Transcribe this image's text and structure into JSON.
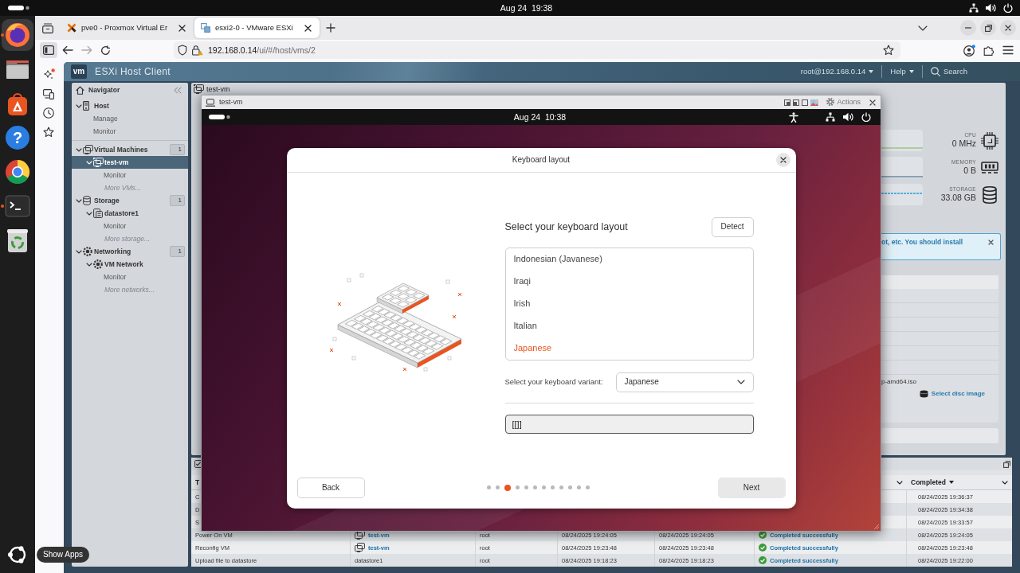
{
  "desktop": {
    "clock": "Aug 24  19:38"
  },
  "dock": {
    "items": [
      {
        "kind": "browser",
        "running": true,
        "focused": true
      },
      {
        "kind": "files",
        "running": false,
        "focused": false
      },
      {
        "kind": "app_center",
        "running": false,
        "focused": false
      },
      {
        "kind": "help",
        "glyph": "?",
        "running": false,
        "focused": false
      },
      {
        "kind": "chromium",
        "running": false,
        "focused": false
      },
      {
        "kind": "terminal",
        "running": true,
        "focused": false
      },
      {
        "kind": "trash",
        "running": false,
        "focused": false
      }
    ],
    "show_apps": {
      "tooltip": "Show Apps"
    }
  },
  "browser": {
    "tabs": [
      {
        "kind": "x_logo",
        "title": "pve0 - Proxmox Virtual Er",
        "selected": false
      },
      {
        "kind": "squares_logo",
        "title": "esxi2-0 - VMware ESXi",
        "selected": true
      }
    ],
    "url": {
      "host": "192.168.0.14",
      "path": "/ui/#/host/vms/2"
    }
  },
  "esxi": {
    "logo": "vm",
    "title": "ESXi Host Client",
    "user_menu": "root@192.168.0.14",
    "help_menu": "Help",
    "search": "Search",
    "navigator": {
      "title": "Navigator",
      "tree": [
        {
          "label": "Host",
          "kind": "host",
          "expanded": true,
          "selected": false,
          "children": [
            {
              "label": "Manage",
              "kind": "page",
              "selected": false
            },
            {
              "label": "Monitor",
              "kind": "page",
              "selected": false
            }
          ]
        },
        {
          "label": "Virtual Machines",
          "kind": "vms",
          "count": "1",
          "expanded": true,
          "selected": false,
          "children": [
            {
              "label": "test-vm",
              "kind": "vm",
              "running": true,
              "expanded": true,
              "selected": true,
              "children": [
                {
                  "label": "Monitor",
                  "kind": "page",
                  "selected": false
                }
              ]
            },
            {
              "label": "More VMs...",
              "kind": "more",
              "selected": false
            }
          ]
        },
        {
          "label": "Storage",
          "kind": "storage",
          "count": "1",
          "expanded": true,
          "selected": false,
          "children": [
            {
              "label": "datastore1",
              "kind": "datastore",
              "expanded": true,
              "selected": false,
              "children": [
                {
                  "label": "Monitor",
                  "kind": "page",
                  "selected": false
                }
              ]
            },
            {
              "label": "More storage...",
              "kind": "more",
              "selected": false
            }
          ]
        },
        {
          "label": "Networking",
          "kind": "network",
          "count": "1",
          "expanded": true,
          "selected": false,
          "children": [
            {
              "label": "VM Network",
              "kind": "portgroup",
              "expanded": true,
              "selected": false,
              "children": [
                {
                  "label": "Monitor",
                  "kind": "page",
                  "selected": false
                }
              ]
            },
            {
              "label": "More networks...",
              "kind": "more",
              "selected": false
            }
          ]
        }
      ]
    },
    "page_title": {
      "text": "test-vm",
      "running": true
    },
    "stats": [
      {
        "kind": "cpu",
        "label": "CPU",
        "value": "0 MHz"
      },
      {
        "kind": "memory",
        "label": "MEMORY",
        "value": "0 B"
      },
      {
        "kind": "storage",
        "label": "STORAGE",
        "value": "33.08 GB"
      }
    ],
    "alert": {
      "text": "ot, etc. You should install"
    },
    "hardware": {
      "iso": "p-amd64.iso",
      "select_disc": "Select disc image"
    },
    "recent_tasks": {
      "columns": {
        "column_1": {
          "label": "T"
        },
        "column_6": {
          "menu": true
        },
        "column_7": {
          "label": "Completed",
          "sorted": true,
          "menu": true
        }
      },
      "rows": [
        {
          "column_1": "C",
          "column_7": "08/24/2025 19:36:37"
        },
        {
          "column_1": "D",
          "column_7": "08/24/2025 19:34:38"
        },
        {
          "column_1": "S",
          "column_7": "08/24/2025 19:33:57"
        },
        {
          "column_1": "Power On VM",
          "column_2": {
            "text": "test-vm",
            "link": true
          },
          "column_3": "root",
          "column_4": "08/24/2025 19:24:05",
          "column_5": "08/24/2025 19:24:05",
          "column_6": {
            "text": "Completed successfully",
            "succeeded": true
          },
          "column_7": "08/24/2025 19:24:05"
        },
        {
          "column_1": "Reconfig VM",
          "column_2": {
            "text": "test-vm",
            "link": true
          },
          "column_3": "root",
          "column_4": "08/24/2025 19:23:48",
          "column_5": "08/24/2025 19:23:48",
          "column_6": {
            "text": "Completed successfully",
            "succeeded": true
          },
          "column_7": "08/24/2025 19:23:48"
        },
        {
          "column_1": "Upload file to datastore",
          "column_2": {
            "text": "datastore1",
            "link": false
          },
          "column_3": "root",
          "column_4": "08/24/2025 19:18:23",
          "column_5": "08/24/2025 19:18:23",
          "column_6": {
            "text": "Completed successfully",
            "succeeded": true
          },
          "column_7": "08/24/2025 19:22:00"
        }
      ]
    }
  },
  "console": {
    "title": "test-vm",
    "actions": "Actions",
    "vm": {
      "clock": "Aug 24  10:38",
      "installer": {
        "title": "Keyboard layout",
        "heading": "Select your keyboard layout",
        "detect": "Detect",
        "layouts": [
          {
            "label": "Indonesian (Javanese)",
            "selected": false
          },
          {
            "label": "Iraqi",
            "selected": false
          },
          {
            "label": "Irish",
            "selected": false
          },
          {
            "label": "Italian",
            "selected": false
          },
          {
            "label": "Japanese",
            "selected": true
          }
        ],
        "variant_label": "Select your keyboard variant:",
        "variant": "Japanese",
        "test_text": "[[]]",
        "back": "Back",
        "next": "Next",
        "steps": [
          {
            "selected": false
          },
          {
            "selected": false
          },
          {
            "selected": true
          },
          {
            "selected": false
          },
          {
            "selected": false
          },
          {
            "selected": false
          },
          {
            "selected": false
          },
          {
            "selected": false
          },
          {
            "selected": false
          },
          {
            "selected": false
          },
          {
            "selected": false
          },
          {
            "selected": false
          }
        ]
      }
    }
  }
}
